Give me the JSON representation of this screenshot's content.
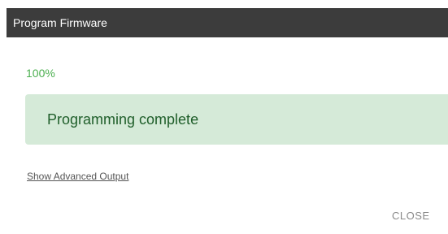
{
  "dialog": {
    "title": "Program Firmware",
    "progress_text": "100%",
    "progress_value": 1.0,
    "status_message": "Programming complete",
    "advanced_link_label": "Show Advanced Output",
    "close_label": "CLOSE"
  },
  "colors": {
    "titlebar_bg": "#3c3c3c",
    "progress_green": "#4caf50",
    "status_bg": "#d5ead8",
    "status_text": "#1f5e2a",
    "muted_text": "#8a8a8a"
  }
}
